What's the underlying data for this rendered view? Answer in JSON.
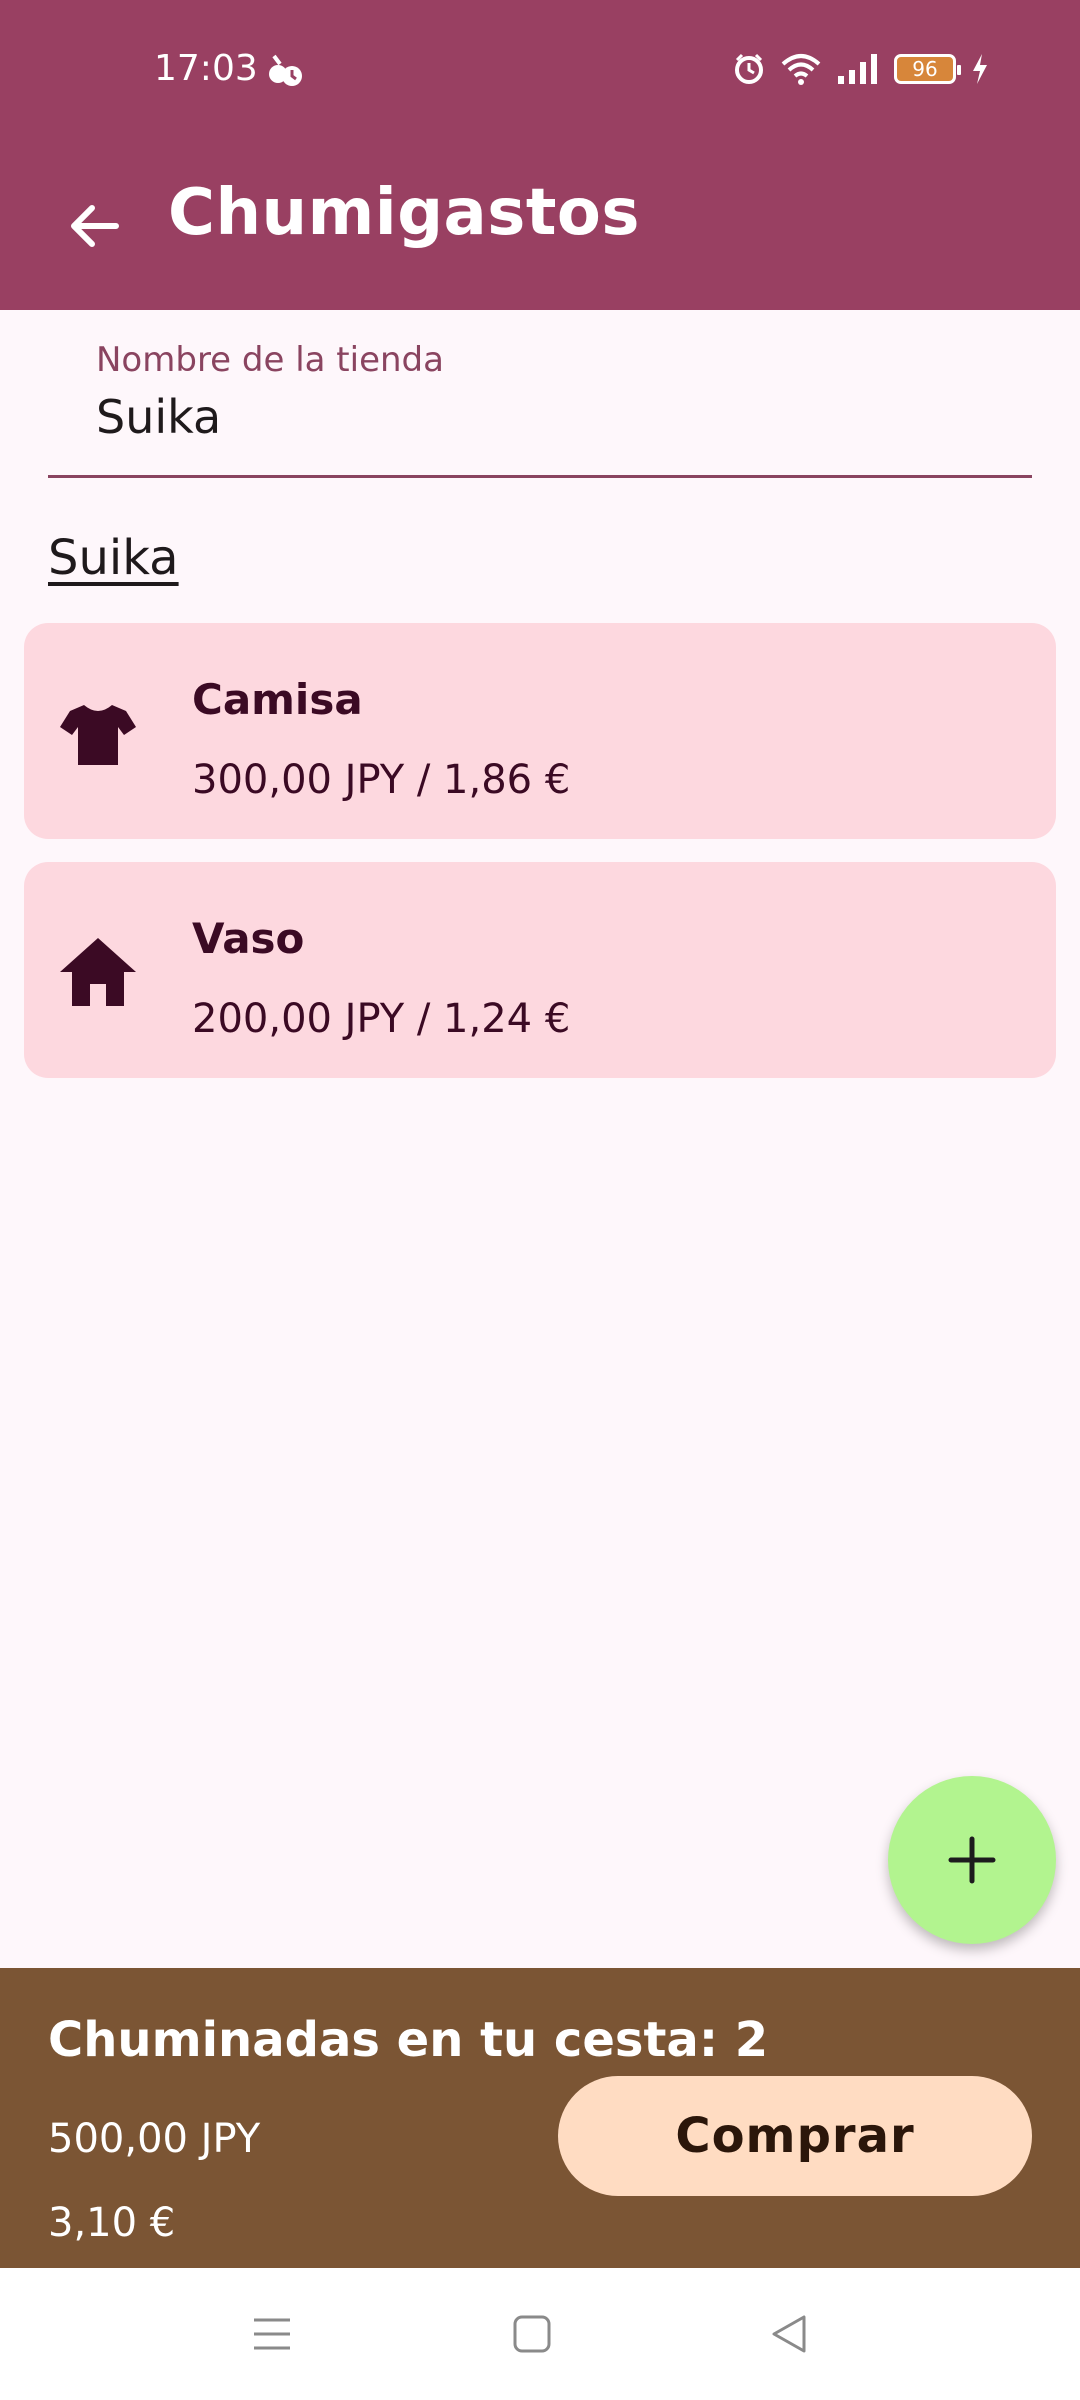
{
  "status_bar": {
    "time": "17:03",
    "battery_level": "96",
    "icons": [
      "alarm-icon",
      "wifi-icon",
      "signal-icon",
      "battery-icon",
      "charging-icon"
    ]
  },
  "app_bar": {
    "title": "Chumigastos",
    "back_icon": "arrow-back-icon",
    "color": "#994062"
  },
  "store_field": {
    "label": "Nombre de la tienda",
    "value": "Suika"
  },
  "store_name": "Suika",
  "items": [
    {
      "name": "Camisa",
      "price": "300,00 JPY / 1,86 €",
      "icon": "tshirt-icon"
    },
    {
      "name": "Vaso",
      "price": "200,00 JPY / 1,24 €",
      "icon": "home-icon"
    }
  ],
  "fab": {
    "icon": "plus-icon",
    "color": "#b2f48f"
  },
  "basket": {
    "title": "Chuminadas en tu cesta: 2",
    "total_jpy": "500,00 JPY",
    "total_eur": "3,10 €",
    "buy_label": "Comprar",
    "panel_color": "#7b5534",
    "button_color": "#ffdcc2"
  },
  "nav_bar": {
    "icons": [
      "menu-icon",
      "home-square-icon",
      "back-triangle-icon"
    ]
  }
}
